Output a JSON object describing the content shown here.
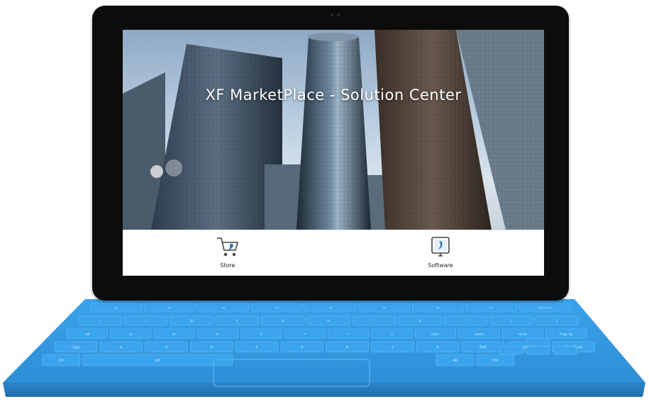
{
  "hero": {
    "title": "XF MarketPlace - Solution Center"
  },
  "tiles": [
    {
      "label": "Store",
      "icon": "cart-icon"
    },
    {
      "label": "Software",
      "icon": "monitor-icon"
    }
  ],
  "keyboard": {
    "color": "#3a9ae0",
    "rows": [
      [
        "Esc",
        "F1",
        "F2",
        "F3",
        "F4",
        "F5",
        "F6",
        "F7",
        "Scroll Lock"
      ],
      [
        "~",
        "!",
        "@",
        "#",
        "$",
        "%",
        "^",
        "&",
        "*",
        "(",
        ")"
      ],
      [
        "Tab",
        "Q",
        "W",
        "E",
        "R",
        "T",
        "Y",
        "U",
        "Enter",
        "Insert",
        "Home",
        "Page Up"
      ],
      [
        "Caps",
        "A",
        "S",
        "D",
        "F",
        "G",
        "H",
        "J",
        "K",
        "Shift",
        "Delete",
        "Page Down"
      ],
      [
        "Ctrl",
        "Alt",
        "Alt",
        "Ctrl"
      ]
    ]
  },
  "colors": {
    "bezel": "#0c0c0c",
    "keyboard": "#3a9ae0",
    "hero_text": "#ffffff"
  }
}
